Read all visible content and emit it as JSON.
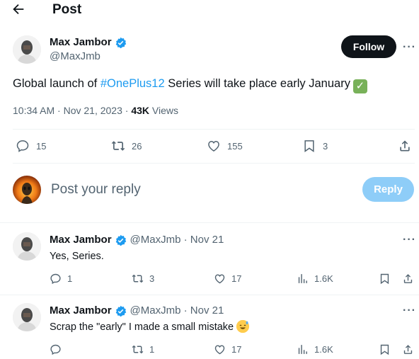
{
  "header": {
    "title": "Post"
  },
  "main_post": {
    "author_name": "Max Jambor",
    "handle": "@MaxJmb",
    "follow_label": "Follow",
    "more_label": "···",
    "text_before": "Global launch of ",
    "hashtag": "#OnePlus12",
    "text_after": " Series will take place early January",
    "check_emoji": "✓",
    "time": "10:34 AM · Nov 21, 2023 · ",
    "views_count": "43K",
    "views_label": " Views",
    "stats": {
      "replies": "15",
      "reposts": "26",
      "likes": "155",
      "bookmarks": "3"
    }
  },
  "composer": {
    "placeholder": "Post your reply",
    "reply_label": "Reply"
  },
  "replies": [
    {
      "author_name": "Max Jambor",
      "handle_time": "@MaxJmb · Nov 21",
      "text": "Yes, Series.",
      "stats": {
        "replies": "1",
        "reposts": "3",
        "likes": "17",
        "views": "1.6K"
      }
    },
    {
      "author_name": "Max Jambor",
      "handle_time": "@MaxJmb · Nov 21",
      "text": "Scrap the \"early\" I made a small mistake",
      "stats": {
        "replies": "",
        "reposts": "1",
        "likes": "17",
        "views": "1.6K"
      }
    }
  ],
  "colors": {
    "accent": "#1d9bf0",
    "text": "#0f1419",
    "muted": "#536471",
    "follow_bg": "#0f1419",
    "reply_btn": "#8ecdf8"
  }
}
